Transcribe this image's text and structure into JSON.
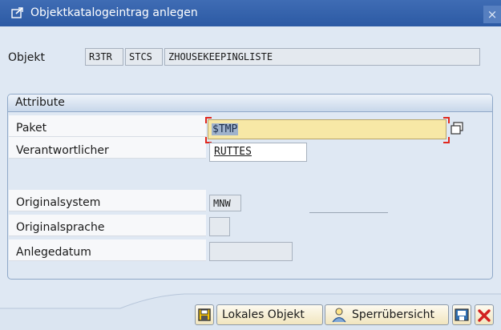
{
  "window": {
    "title": "Objektkatalogeintrag anlegen",
    "close_glyph": "×"
  },
  "objekt": {
    "label": "Objekt",
    "pgmid": "R3TR",
    "type": "STCS",
    "name": "ZHOUSEKEEPINGLISTE"
  },
  "attribute": {
    "title": "Attribute",
    "paket_label": "Paket",
    "paket_value": "$TMP",
    "verantwortlicher_label": "Verantwortlicher",
    "verantwortlicher_value": "RUTTES",
    "originalsystem_label": "Originalsystem",
    "originalsystem_value": "MNW",
    "originalsprache_label": "Originalsprache",
    "originalsprache_value": "",
    "anlegedatum_label": "Anlegedatum",
    "anlegedatum_value": ""
  },
  "buttons": {
    "lokales_objekt": "Lokales Objekt",
    "sperruebersicht": "Sperrübersicht"
  },
  "icons": {
    "title": "create-entry-icon",
    "save": "save-icon",
    "lock_overview": "lock-overview-icon",
    "print": "print-icon",
    "cancel": "cancel-icon",
    "value_help": "value-help-icon"
  }
}
